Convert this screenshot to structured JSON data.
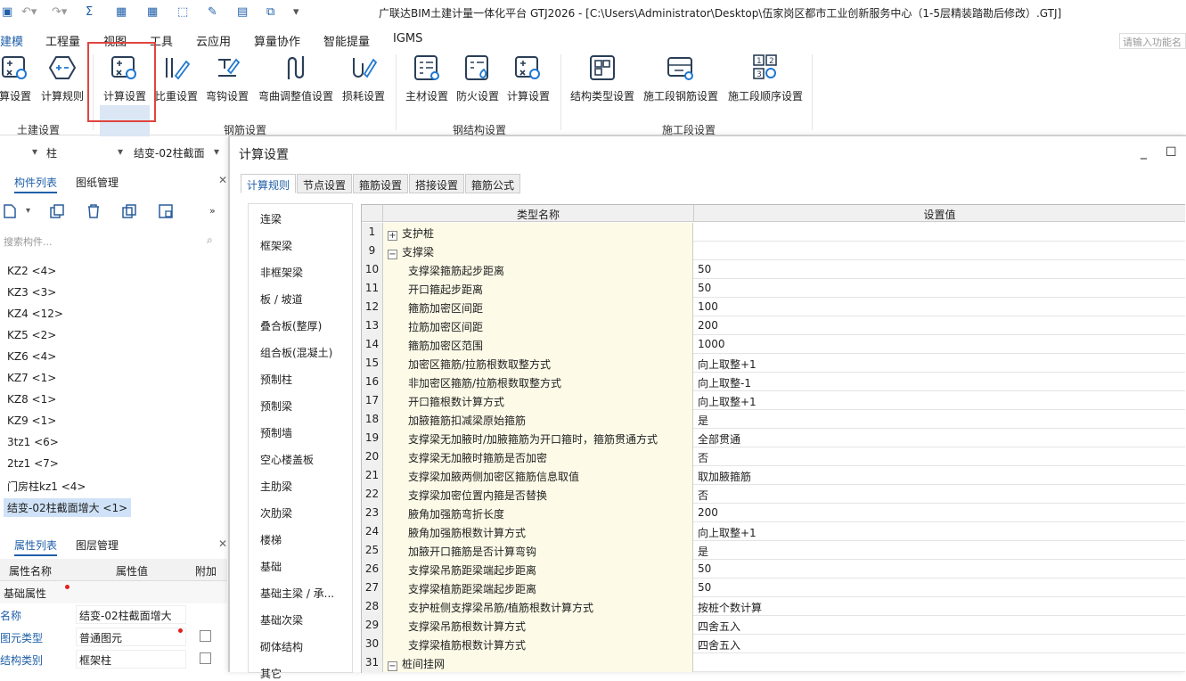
{
  "titlebar": {
    "title": "广联达BIM土建计量一体化平台 GTJ2026 - [C:\\Users\\Administrator\\Desktop\\伍家岗区都市工业创新服务中心（1-5层精装踏勘后修改）.GTJ]"
  },
  "menubar": {
    "items": [
      "建模",
      "工程量",
      "视图",
      "工具",
      "云应用",
      "算量协作",
      "智能提量",
      "IGMS"
    ],
    "search_placeholder": "请输入功能名"
  },
  "ribbon": {
    "buttons": [
      "算设置",
      "计算规则",
      "计算设置",
      "比重设置",
      "弯钩设置",
      "弯曲调整值设置",
      "损耗设置",
      "主材设置",
      "防火设置",
      "计算设置",
      "结构类型设置",
      "施工段钢筋设置",
      "施工段顺序设置"
    ],
    "groups": [
      "土建设置",
      "钢筋设置",
      "钢结构设置",
      "施工段设置"
    ]
  },
  "leftpane": {
    "combo1": "柱",
    "combo2": "结变-02柱截面",
    "tabs": [
      "构件列表",
      "图纸管理"
    ],
    "search_placeholder": "搜索构件...",
    "components": [
      "KZ2 <4>",
      "KZ3 <3>",
      "KZ4 <12>",
      "KZ5 <2>",
      "KZ6 <4>",
      "KZ7 <1>",
      "KZ8 <1>",
      "KZ9 <1>",
      "3tz1 <6>",
      "2tz1 <7>",
      "门房柱kz1 <4>",
      "结变-02柱截面增大 <1>"
    ],
    "prop_tabs": [
      "属性列表",
      "图层管理"
    ],
    "prop_headers": [
      "属性名称",
      "属性值",
      "附加"
    ],
    "prop_section": "基础属性",
    "props": [
      {
        "name": "名称",
        "value": "结变-02柱截面增大"
      },
      {
        "name": "图元类型",
        "value": "普通图元"
      },
      {
        "name": "结构类别",
        "value": "框架柱"
      }
    ]
  },
  "dialog": {
    "title": "计算设置",
    "tabs": [
      "计算规则",
      "节点设置",
      "箍筋设置",
      "搭接设置",
      "箍筋公式"
    ],
    "categories": [
      "连梁",
      "框架梁",
      "非框架梁",
      "板 / 坡道",
      "叠合板(整厚)",
      "组合板(混凝土)",
      "预制柱",
      "预制梁",
      "预制墙",
      "空心楼盖板",
      "主肋梁",
      "次肋梁",
      "楼梯",
      "基础",
      "基础主梁 / 承...",
      "基础次梁",
      "砌体结构",
      "其它"
    ],
    "grid_headers": [
      "类型名称",
      "设置值"
    ],
    "rows": [
      {
        "num": "1",
        "name": "支护桩",
        "value": "",
        "group": true,
        "toggle": "+"
      },
      {
        "num": "9",
        "name": "支撑梁",
        "value": "",
        "group": true,
        "toggle": "−"
      },
      {
        "num": "10",
        "name": "支撑梁箍筋起步距离",
        "value": "50"
      },
      {
        "num": "11",
        "name": "开口箍起步距离",
        "value": "50"
      },
      {
        "num": "12",
        "name": "箍筋加密区间距",
        "value": "100"
      },
      {
        "num": "13",
        "name": "拉筋加密区间距",
        "value": "200"
      },
      {
        "num": "14",
        "name": "箍筋加密区范围",
        "value": "1000"
      },
      {
        "num": "15",
        "name": "加密区箍筋/拉筋根数取整方式",
        "value": "向上取整+1"
      },
      {
        "num": "16",
        "name": "非加密区箍筋/拉筋根数取整方式",
        "value": "向上取整-1"
      },
      {
        "num": "17",
        "name": "开口箍根数计算方式",
        "value": "向上取整+1"
      },
      {
        "num": "18",
        "name": "加腋箍筋扣减梁原始箍筋",
        "value": "是"
      },
      {
        "num": "19",
        "name": "支撑梁无加腋时/加腋箍筋为开口箍时，箍筋贯通方式",
        "value": "全部贯通"
      },
      {
        "num": "20",
        "name": "支撑梁无加腋时箍筋是否加密",
        "value": "否"
      },
      {
        "num": "21",
        "name": "支撑梁加腋两侧加密区箍筋信息取值",
        "value": "取加腋箍筋"
      },
      {
        "num": "22",
        "name": "支撑梁加密位置内箍是否替换",
        "value": "否"
      },
      {
        "num": "23",
        "name": "腋角加强筋弯折长度",
        "value": "200"
      },
      {
        "num": "24",
        "name": "腋角加强筋根数计算方式",
        "value": "向上取整+1"
      },
      {
        "num": "25",
        "name": "加腋开口箍筋是否计算弯钩",
        "value": "是"
      },
      {
        "num": "26",
        "name": "支撑梁吊筋距梁端起步距离",
        "value": "50"
      },
      {
        "num": "27",
        "name": "支撑梁植筋距梁端起步距离",
        "value": "50"
      },
      {
        "num": "28",
        "name": "支护桩侧支撑梁吊筋/植筋根数计算方式",
        "value": "按桩个数计算"
      },
      {
        "num": "29",
        "name": "支撑梁吊筋根数计算方式",
        "value": "四舍五入"
      },
      {
        "num": "30",
        "name": "支撑梁植筋根数计算方式",
        "value": "四舍五入"
      },
      {
        "num": "31",
        "name": "桩间挂网",
        "value": "",
        "group": true,
        "toggle": "−"
      }
    ]
  }
}
